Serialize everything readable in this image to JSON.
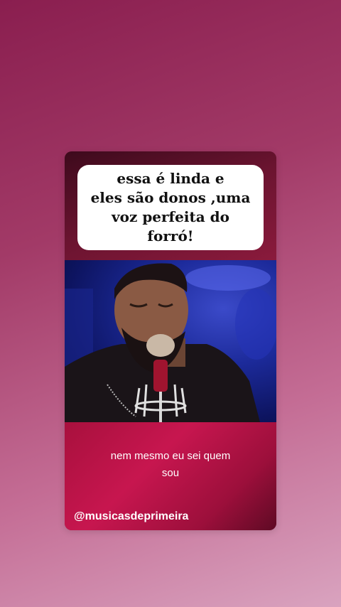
{
  "story": {
    "caption": "essa é linda e\neles são donos ,uma\nvoz perfeita do\nforró!",
    "lyric": "nem mesmo eu sei quem\nsou",
    "handle": "@musicasdeprimeira"
  },
  "colors": {
    "background_top": "#8a1e4f",
    "background_bottom": "#d9a3bf",
    "card_accent": "#c7164f",
    "caption_bg": "#ffffff",
    "caption_text": "#111111",
    "lyric_text": "#ffffff"
  }
}
